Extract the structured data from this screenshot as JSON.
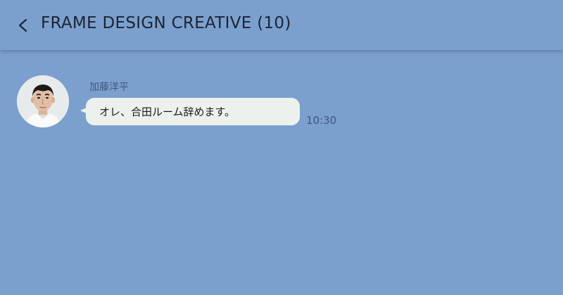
{
  "header": {
    "back_icon": "chevron-left-icon",
    "title": "FRAME DESIGN CREATIVE (10)"
  },
  "messages": [
    {
      "sender": "加藤洋平",
      "avatar": "user-avatar",
      "text": "オレ、合田ルーム辞めます。",
      "time": "10:30"
    }
  ],
  "colors": {
    "background": "#7BA0CE",
    "bubble": "#EDF1EE",
    "meta_text": "#41597D",
    "title_text": "#1C2433"
  }
}
